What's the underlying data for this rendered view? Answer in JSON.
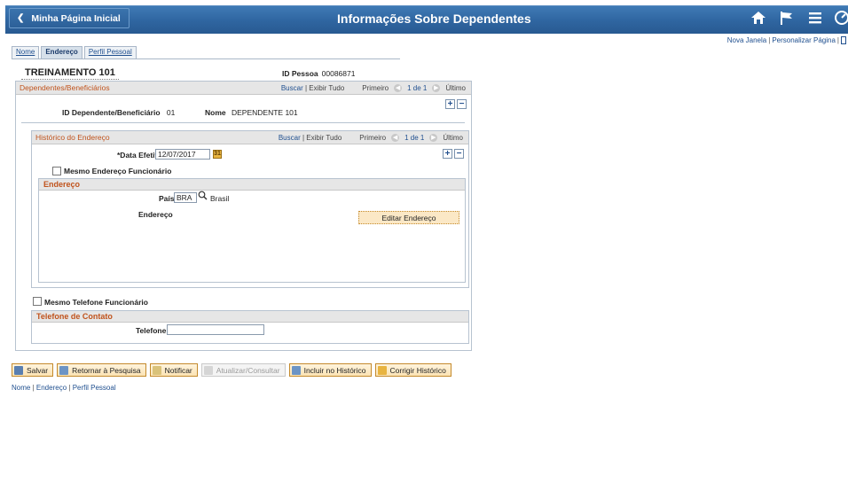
{
  "header": {
    "home_label": "Minha Página Inicial",
    "title": "Informações Sobre Dependentes",
    "icons": [
      "home-icon",
      "flag-icon",
      "menu-icon",
      "navbar-icon"
    ]
  },
  "top_links": {
    "new_window": "Nova Janela",
    "personalize": "Personalizar Página"
  },
  "tabs": [
    "Nome",
    "Endereço",
    "Perfil Pessoal"
  ],
  "employee": {
    "name": "TREINAMENTO 101",
    "id_label": "ID Pessoa",
    "id_value": "00086871"
  },
  "dependents": {
    "title": "Dependentes/Beneficiários",
    "find": "Buscar",
    "view_all": "Exibir Tudo",
    "first": "Primeiro",
    "count": "1 de 1",
    "last": "Último",
    "id_label": "ID Dependente/Beneficiário",
    "id_value": "01",
    "name_label": "Nome",
    "name_value": "DEPENDENTE 101"
  },
  "address_history": {
    "title": "Histórico do Endereço",
    "find": "Buscar",
    "view_all": "Exibir Tudo",
    "first": "Primeiro",
    "count": "1 de 1",
    "last": "Último",
    "effdt_label": "*Data Efetiva",
    "effdt_value": "12/07/2017",
    "same_address_label": "Mesmo Endereço Funcionário",
    "address_section": "Endereço",
    "country_label": "País",
    "country_code": "BRA",
    "country_name": "Brasil",
    "address_label": "Endereço",
    "edit_button": "Editar Endereço"
  },
  "phone": {
    "same_phone_label": "Mesmo Telefone Funcionário",
    "section": "Telefone de Contato",
    "phone_label": "Telefone",
    "phone_value": ""
  },
  "toolbar": {
    "save": "Salvar",
    "return": "Retornar à Pesquisa",
    "notify": "Notificar",
    "update": "Atualizar/Consultar",
    "include_history": "Incluir no Histórico",
    "correct_history": "Corrigir Histórico"
  },
  "bottom_links": [
    "Nome",
    "Endereço",
    "Perfil Pessoal"
  ]
}
